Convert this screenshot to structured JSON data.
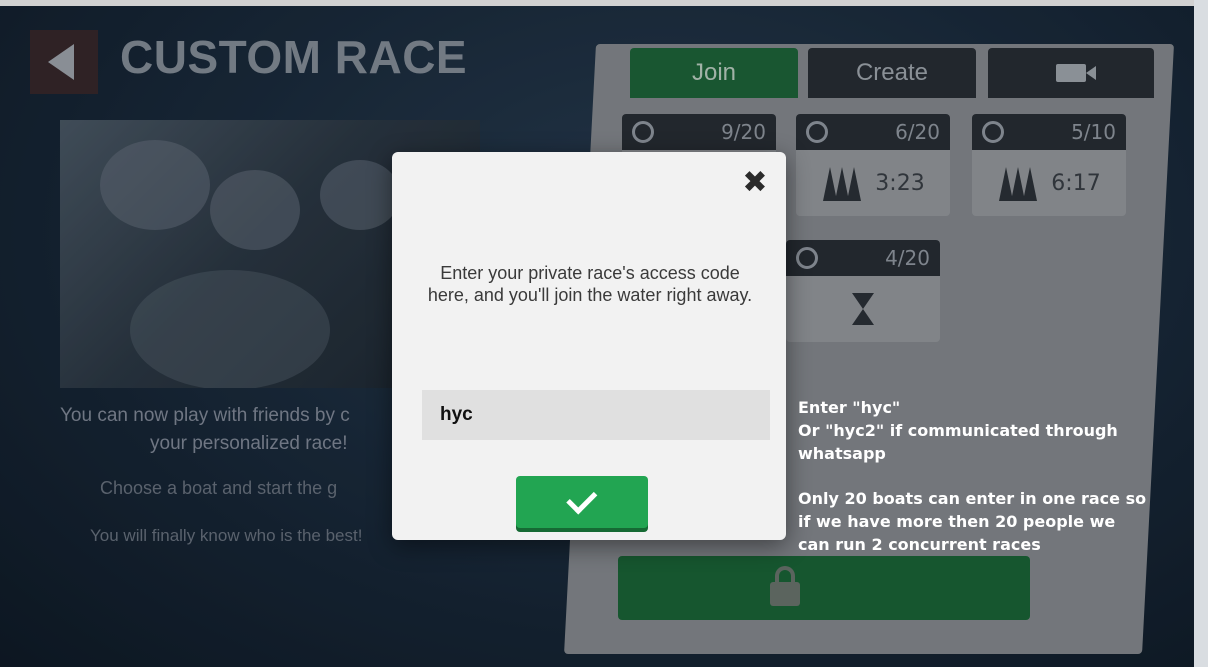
{
  "header": {
    "title": "CUSTOM RACE",
    "back_icon": "back-arrow-icon"
  },
  "promo": {
    "line1": "You can now play with friends by c",
    "line2": "your personalized race!",
    "line3": "Choose a boat and start the g",
    "line4": "You will finally know who is the best!"
  },
  "tabs": [
    {
      "label": "Join",
      "active": true
    },
    {
      "label": "Create",
      "active": false
    },
    {
      "label": "",
      "icon": "camera-icon",
      "active": false
    }
  ],
  "races": [
    {
      "players": "9/20",
      "time": ""
    },
    {
      "players": "6/20",
      "time": "3:23"
    },
    {
      "players": "5/10",
      "time": "6:17"
    },
    {
      "players": "4/20",
      "time": "",
      "icon": "hourglass-icon"
    }
  ],
  "modal": {
    "message": "Enter your private race's access code here, and you'll join the water right away.",
    "code_value": "hyc",
    "close_icon": "close-icon",
    "confirm_icon": "checkmark-icon"
  },
  "annotation": {
    "line1": "Enter \"hyc\"",
    "line2": "Or \"hyc2\" if communicated through",
    "line3": "whatsapp",
    "line4": "Only 20 boats can enter in one race so",
    "line5": "if we have more then 20 people we",
    "line6": "can run 2 concurrent races"
  },
  "colors": {
    "accent_green": "#22a552",
    "panel_dark": "#2a3038",
    "background": "#1a2b3d"
  }
}
